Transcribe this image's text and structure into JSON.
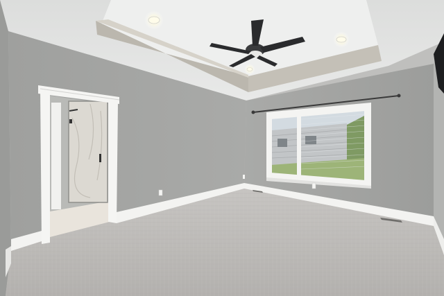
{
  "scene": {
    "description_tag": "empty-bedroom-interior",
    "colors": {
      "ceiling": "#e4e5e4",
      "tray_ceiling": "#eeefee",
      "tray_soffit": "#bdb9b1",
      "wall_left": "#a5a6a4",
      "wall_right": "#a4a5a3",
      "wall_far_left": "#9b9c9a",
      "carpet": "#bdbbb8",
      "trim": "#f3f3f1",
      "fan_dark": "#2a2b2d",
      "window_view": "#c9d2d9",
      "grass": "#8aa56b",
      "tile": "#e9e4dc",
      "shower_glass": "#d8d6d0",
      "light_glow": "#fffdf0"
    },
    "icons": [
      "ceiling-fan-icon",
      "recessed-light-icon",
      "window-icon",
      "door-icon",
      "outlet-icon",
      "floor-vent-icon",
      "curtain-rod-icon",
      "tv-icon"
    ]
  }
}
